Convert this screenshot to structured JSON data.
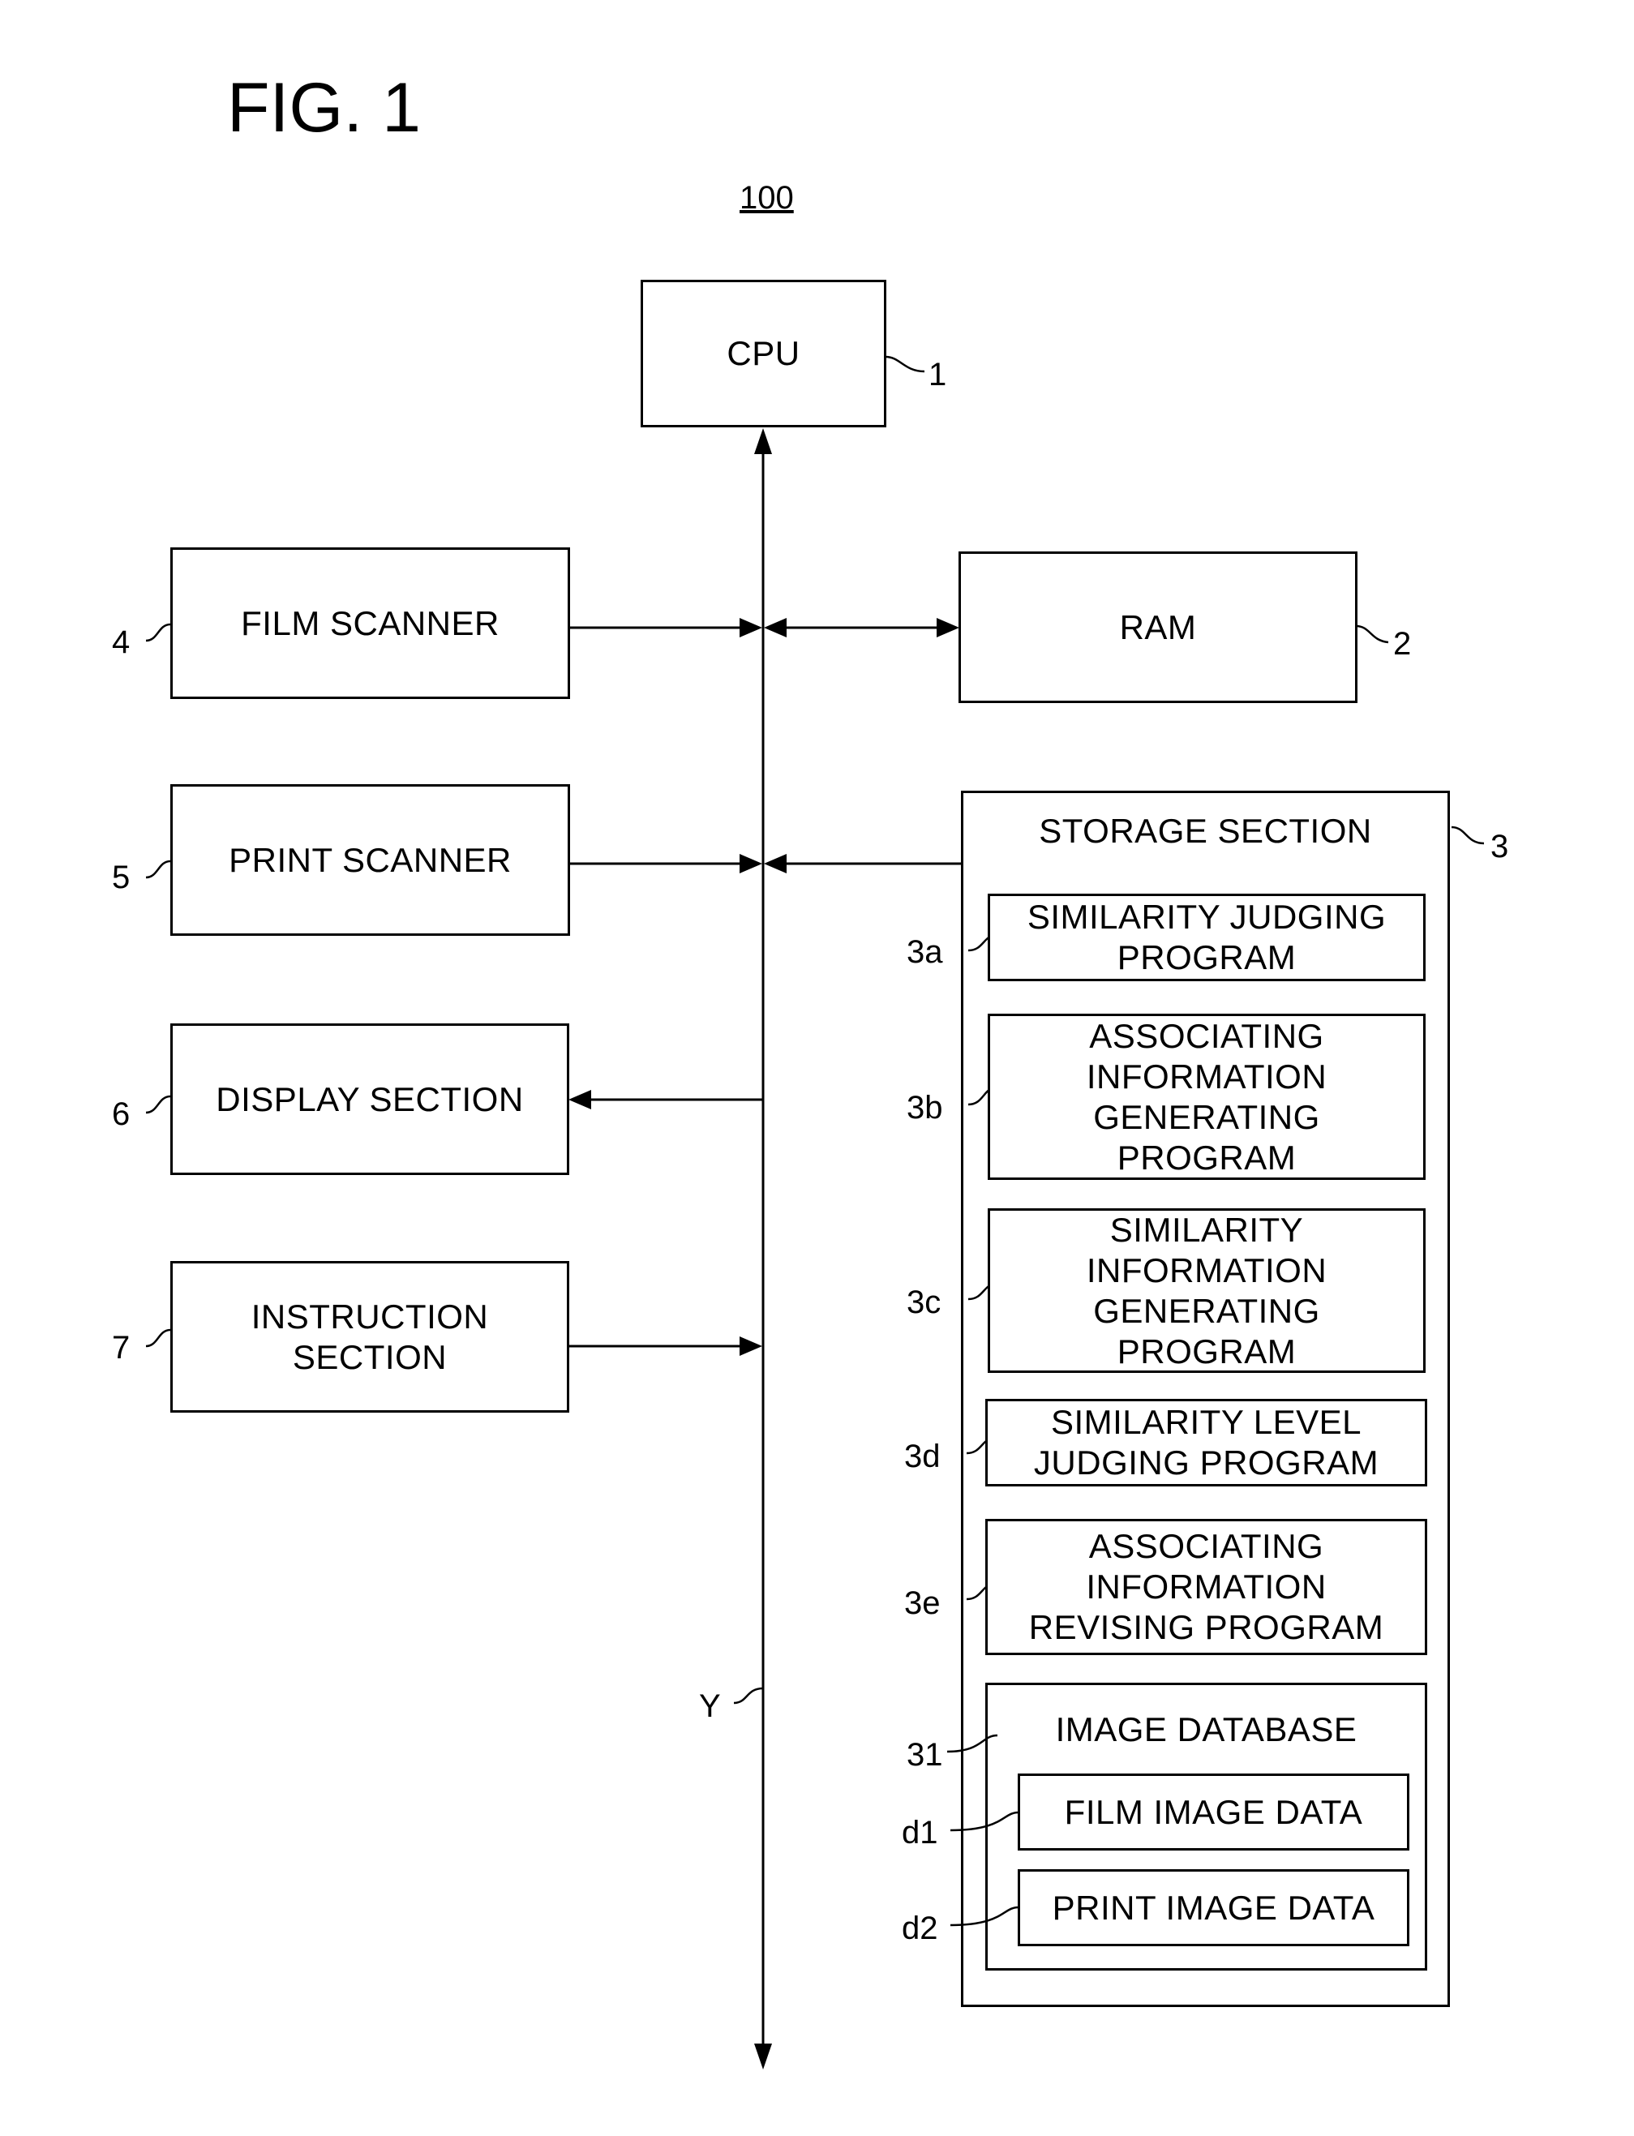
{
  "figure": {
    "title": "FIG. 1",
    "system_ref": "100",
    "bus_ref": "Y"
  },
  "blocks": {
    "cpu": {
      "label": "CPU",
      "ref": "1"
    },
    "ram": {
      "label": "RAM",
      "ref": "2"
    },
    "film_scanner": {
      "label": "FILM SCANNER",
      "ref": "4"
    },
    "print_scanner": {
      "label": "PRINT SCANNER",
      "ref": "5"
    },
    "display_section": {
      "label": "DISPLAY SECTION",
      "ref": "6"
    },
    "instruction_section": {
      "label": "INSTRUCTION\nSECTION",
      "ref": "7"
    }
  },
  "storage": {
    "label": "STORAGE SECTION",
    "ref": "3",
    "programs": [
      {
        "label": "SIMILARITY JUDGING\nPROGRAM",
        "ref": "3a"
      },
      {
        "label": "ASSOCIATING\nINFORMATION\nGENERATING\nPROGRAM",
        "ref": "3b"
      },
      {
        "label": "SIMILARITY\nINFORMATION\nGENERATING\nPROGRAM",
        "ref": "3c"
      },
      {
        "label": "SIMILARITY LEVEL\nJUDGING PROGRAM",
        "ref": "3d"
      },
      {
        "label": "ASSOCIATING\nINFORMATION\nREVISING PROGRAM",
        "ref": "3e"
      }
    ],
    "database": {
      "label": "IMAGE DATABASE",
      "ref": "31",
      "items": [
        {
          "label": "FILM IMAGE DATA",
          "ref": "d1"
        },
        {
          "label": "PRINT IMAGE DATA",
          "ref": "d2"
        }
      ]
    }
  },
  "connections": [
    {
      "from": "bus",
      "to": "cpu",
      "direction": "to-cpu"
    },
    {
      "from": "film_scanner",
      "to": "bus",
      "direction": "to-bus"
    },
    {
      "from": "bus",
      "to": "ram",
      "direction": "bidirectional"
    },
    {
      "from": "print_scanner",
      "to": "bus",
      "direction": "to-bus"
    },
    {
      "from": "storage",
      "to": "bus",
      "direction": "to-bus"
    },
    {
      "from": "bus",
      "to": "display_section",
      "direction": "to-display"
    },
    {
      "from": "instruction_section",
      "to": "bus",
      "direction": "to-bus"
    }
  ]
}
